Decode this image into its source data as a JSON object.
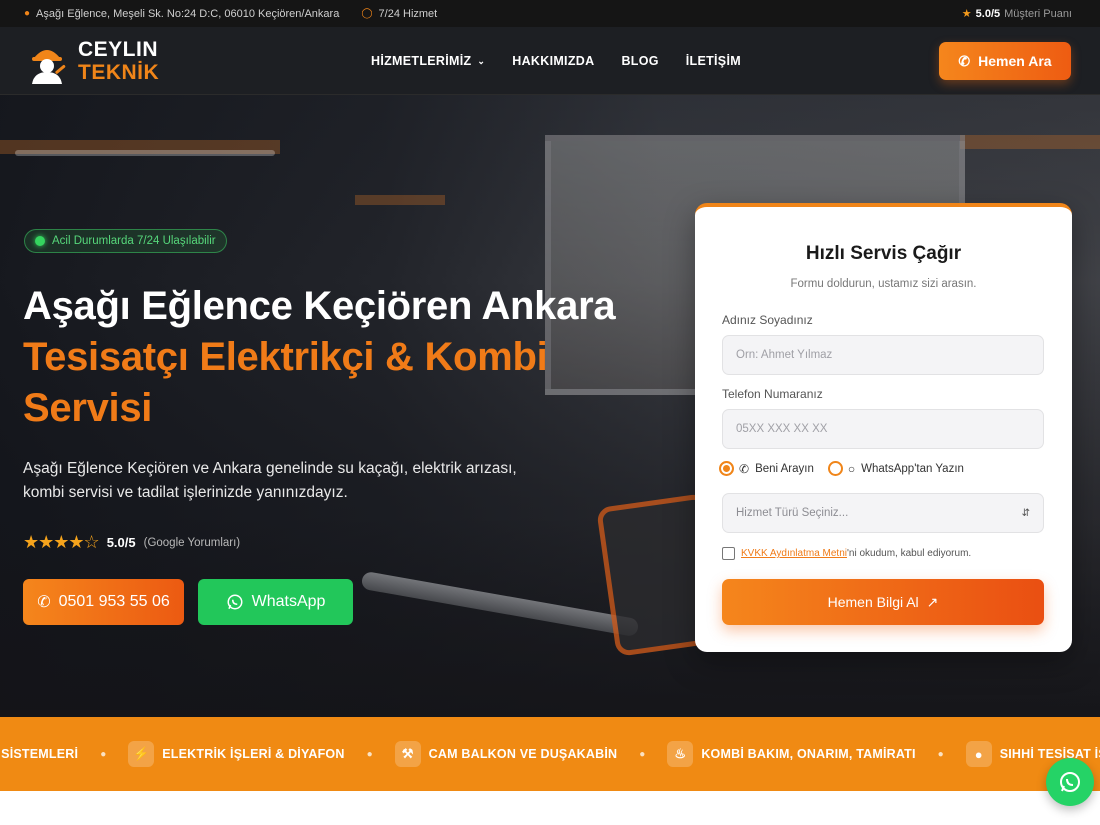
{
  "topbar": {
    "address": "Aşağı Eğlence, Meşeli Sk. No:24 D:C, 06010 Keçiören/Ankara",
    "service": "7/24 Hizmet",
    "score": "5.0/5",
    "score_label": "Müşteri Puanı"
  },
  "header": {
    "logo_line1": "CEYLIN",
    "logo_line2": "TEKNİK",
    "nav": [
      "HİZMETLERİMİZ",
      "HAKKIMIZDA",
      "BLOG",
      "İLETİŞİM"
    ],
    "call_label": "Hemen Ara"
  },
  "hero": {
    "badge": "Acil Durumlarda 7/24 Ulaşılabilir",
    "title_white": "Aşağı Eğlence Keçiören Ankara",
    "title_orange_1": "Tesisatçı Elektrikçi & Kombi",
    "title_orange_2": "Servisi",
    "lead": "Aşağı Eğlence Keçiören ve Ankara genelinde su kaçağı, elektrik arızası, kombi servisi ve tadilat işlerinizde yanınızdayız.",
    "rating_value": 4.5,
    "rating_text": "5.0/5",
    "rating_source": "(Google Yorumları)",
    "phone_button": "0501 953 55 06",
    "whatsapp_button": "WhatsApp"
  },
  "form": {
    "title": "Hızlı Servis Çağır",
    "subtitle": "Formu doldurun, ustamız sizi arasın.",
    "name_label": "Adınız Soyadınız",
    "name_placeholder": "Örn: Ahmet Yılmaz",
    "phone_label": "Telefon Numaranız",
    "phone_placeholder": "05XX XXX XX XX",
    "radio_call": "Beni Arayın",
    "radio_whatsapp": "WhatsApp'tan Yazın",
    "select_placeholder": "Hizmet Türü Seçiniz...",
    "kvkk_link": "KVKK Aydınlatma Metni",
    "kvkk_text": "'ni okudum, kabul ediyorum.",
    "submit": "Hemen Bilgi Al"
  },
  "ticker": {
    "items": [
      {
        "label": "ATMA SİSTEMLERİ",
        "icon": "none"
      },
      {
        "label": "ELEKTRİK İŞLERİ & DİYAFON",
        "icon": "bolt-icon"
      },
      {
        "label": "CAM BALKON VE DUŞAKABİN",
        "icon": "hammer-icon"
      },
      {
        "label": "KOMBİ BAKIM, ONARIM, TAMİRATI",
        "icon": "flame-icon"
      },
      {
        "label": "SIHHİ TESİSAT İŞLERİ",
        "icon": "drop-icon"
      }
    ]
  },
  "colors": {
    "accent": "#f08519",
    "whatsapp": "#22c75a",
    "dark": "#151515"
  }
}
